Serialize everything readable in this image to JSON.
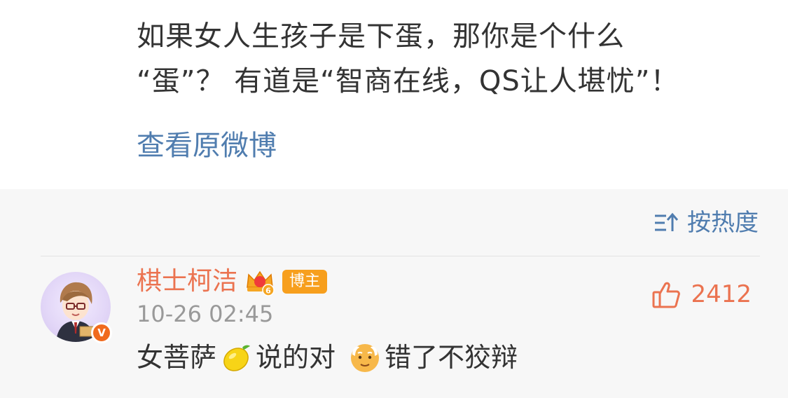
{
  "post": {
    "lines": [
      "如果女人生孩子是下蛋，那你是个什么",
      "“蛋”？ 有道是“智商在线，QS让人堪忧”！"
    ],
    "view_original": "查看原微博"
  },
  "comments": {
    "sort_label": "按热度",
    "items": [
      {
        "username": "棋士柯洁",
        "level": "6",
        "badge": "博主",
        "timestamp": "10-26 02:45",
        "text_part1": "女菩萨",
        "text_part2": "说的对",
        "text_part3": "错了不狡辩",
        "emojis": [
          "lemon-emoji",
          "old-man-emoji"
        ],
        "likes": "2412",
        "verified": "V"
      }
    ]
  },
  "colors": {
    "link": "#507daf",
    "accent": "#eb7350",
    "badge": "#f79f1d",
    "muted": "#999999",
    "text": "#333333",
    "comment_bg": "#f7f7f7"
  }
}
